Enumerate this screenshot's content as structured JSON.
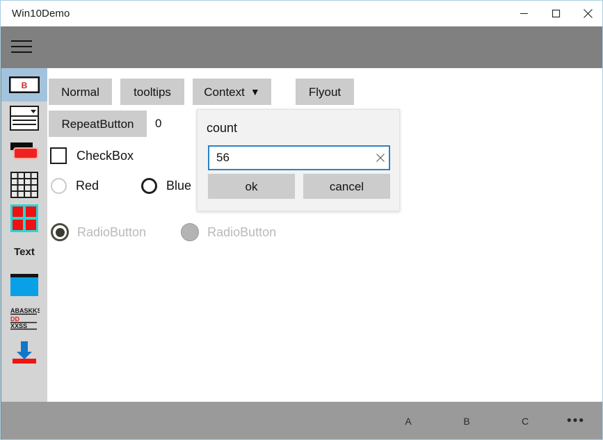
{
  "window": {
    "title": "Win10Demo",
    "caption": {
      "minimize": "minimize",
      "maximize": "maximize",
      "close": "close"
    }
  },
  "appbar": {
    "menu_label": "hamburger-menu"
  },
  "sidebar": {
    "items": [
      {
        "icon": "button-icon",
        "label": "",
        "selected": true
      },
      {
        "icon": "combobox-icon",
        "label": "",
        "selected": false
      },
      {
        "icon": "progressbar-icon",
        "label": "",
        "selected": false
      },
      {
        "icon": "grid-icon",
        "label": "",
        "selected": false
      },
      {
        "icon": "panes-icon",
        "label": "",
        "selected": false
      },
      {
        "icon": "text-icon",
        "label": "Text",
        "selected": false
      },
      {
        "icon": "window-icon",
        "label": "",
        "selected": false
      },
      {
        "icon": "document-icon",
        "label": "",
        "selected": false
      },
      {
        "icon": "download-icon",
        "label": "",
        "selected": false
      }
    ]
  },
  "main": {
    "buttons": {
      "normal": "Normal",
      "tooltips": "tooltips",
      "context": "Context",
      "context_caret": "▼",
      "flyout": "Flyout"
    },
    "repeat": {
      "label": "RepeatButton",
      "count": "0"
    },
    "checkbox": {
      "label": "CheckBox",
      "checked": false
    },
    "color_radios": [
      {
        "label": "Red",
        "selected": false,
        "style": "dim"
      },
      {
        "label": "Blue",
        "selected": false,
        "style": "solid"
      }
    ],
    "disabled_radios": [
      {
        "label": "RadioButton",
        "selected": true
      },
      {
        "label": "RadioButton",
        "selected": false
      }
    ]
  },
  "dialog": {
    "title": "count",
    "input_value": "56",
    "input_placeholder": "",
    "clear_icon": "clear-icon",
    "ok_label": "ok",
    "cancel_label": "cancel"
  },
  "commandbar": {
    "items": [
      "A",
      "B",
      "C"
    ],
    "overflow": "•••"
  },
  "colors": {
    "accent": "#2b82c4",
    "appbar": "#808080",
    "commandbar": "#9a9a9a",
    "sidebar": "#d4d4d4",
    "sidebar_selected": "#a3c3dc",
    "button_face": "#cccccc",
    "dialog_bg": "#f2f2f2",
    "window_border": "#a8cfe0"
  }
}
